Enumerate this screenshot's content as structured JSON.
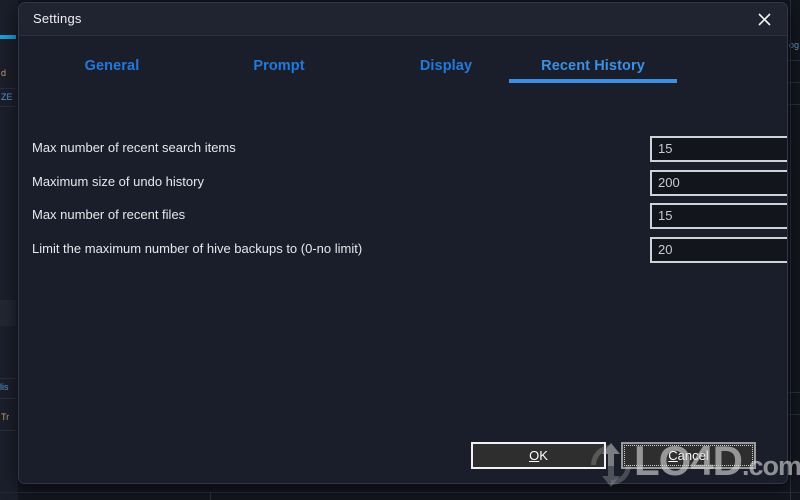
{
  "window": {
    "title": "Settings",
    "close_icon": "close-icon"
  },
  "tabs": [
    {
      "label": "General",
      "active": false
    },
    {
      "label": "Prompt",
      "active": false
    },
    {
      "label": "Display",
      "active": false
    },
    {
      "label": "Recent History",
      "active": true
    }
  ],
  "settings_rows": [
    {
      "label": "Max number of recent search items",
      "value": "15"
    },
    {
      "label": "Maximum size of undo history",
      "value": "200"
    },
    {
      "label": "Max number of recent files",
      "value": "15"
    },
    {
      "label": "Limit the maximum number of hive backups to (0-no limit)",
      "value": "20"
    }
  ],
  "footer": {
    "ok_label": "OK",
    "ok_accel": "O",
    "cancel_label": "Cancel",
    "cancel_accel": "C"
  },
  "watermark": {
    "text": "LO4D",
    "suffix": ".com",
    "logo_icon": "refresh-arrows-icon"
  },
  "background_app": {
    "fragments": [
      "d",
      "ZE",
      "lis",
      "Tr",
      "og"
    ]
  },
  "colors": {
    "dialog_bg": "#1a1e2a",
    "titlebar_bg": "#202430",
    "tab_accent": "#3d8fe4",
    "tab_text": "#2279dd",
    "label_text": "#e6e8ec",
    "button_bg": "#2e2e2e",
    "button_border": "#f2f2f2",
    "spin_border": "#cfd2d6"
  }
}
